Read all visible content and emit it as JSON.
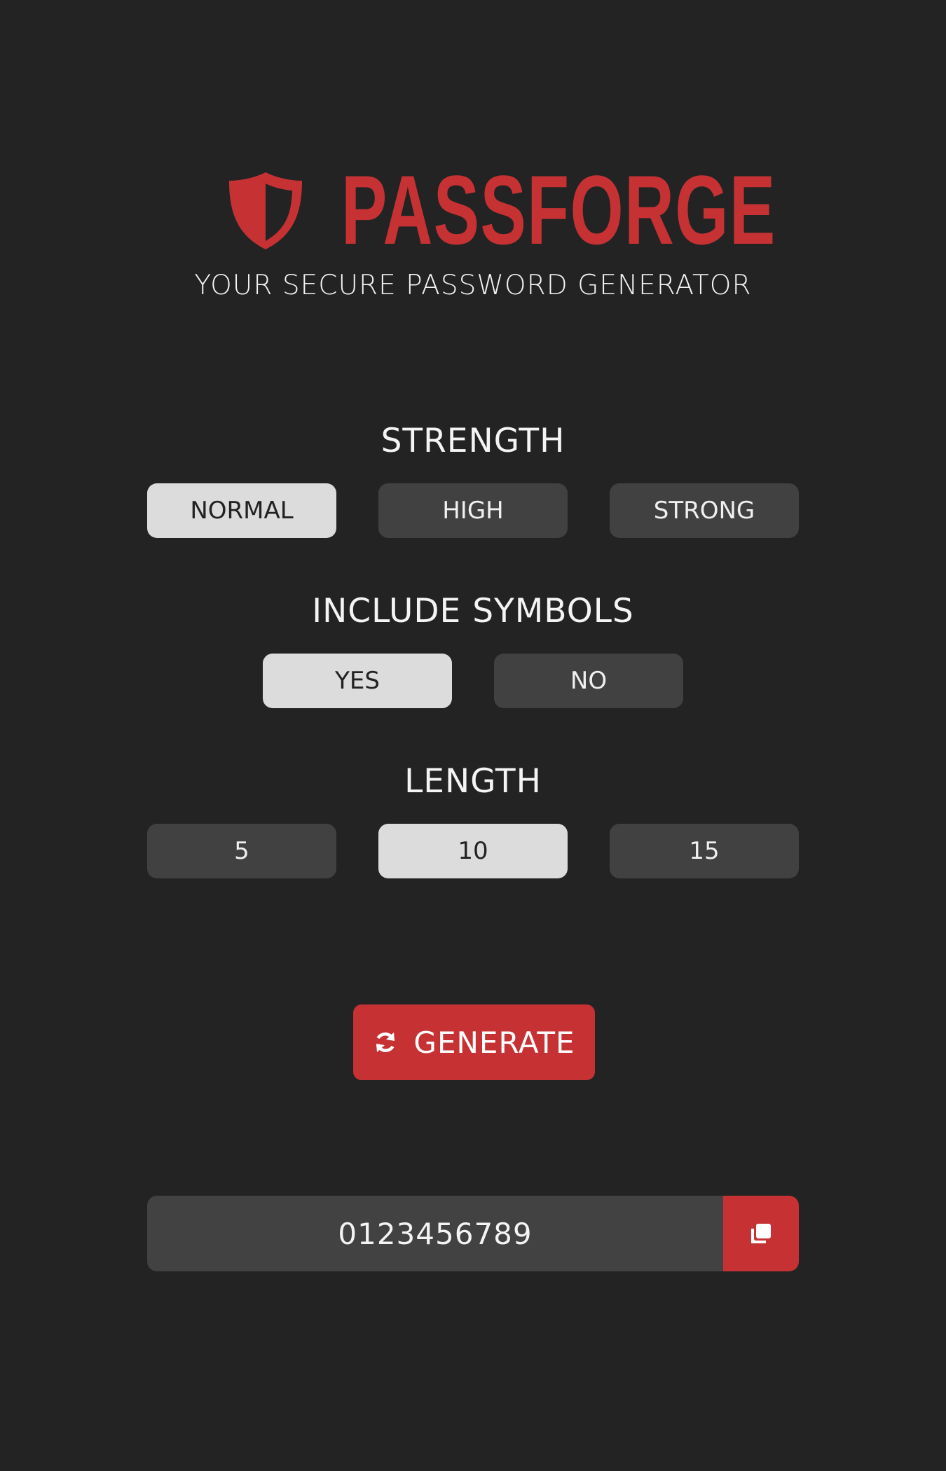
{
  "app": {
    "title": "PASSFORGE",
    "tagline": "YOUR SECURE PASSWORD GENERATOR",
    "logo_icon": "shield-icon"
  },
  "strength": {
    "label": "STRENGTH",
    "options": [
      "NORMAL",
      "HIGH",
      "STRONG"
    ],
    "selected": "NORMAL"
  },
  "symbols": {
    "label": "INCLUDE SYMBOLS",
    "options": [
      "YES",
      "NO"
    ],
    "selected": "YES"
  },
  "length": {
    "label": "LENGTH",
    "options": [
      "5",
      "10",
      "15"
    ],
    "selected": "10"
  },
  "generate": {
    "label": "GENERATE",
    "icon": "refresh-icon"
  },
  "output": {
    "password": "0123456789",
    "copy_icon": "copy-icon"
  },
  "colors": {
    "background": "#232323",
    "accent": "#c63234",
    "button": "#414141",
    "button_selected": "#dcdcdc"
  }
}
